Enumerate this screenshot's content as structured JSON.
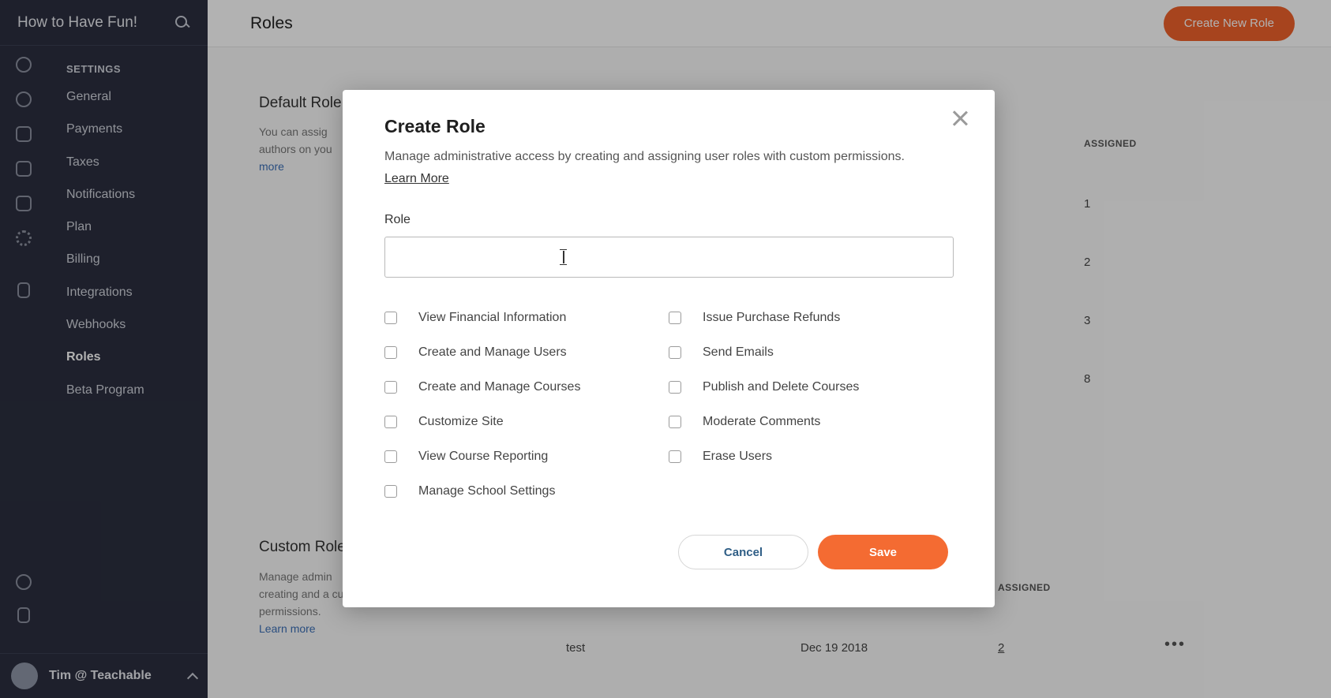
{
  "sidebar": {
    "school_name": "How to Have Fun!",
    "section_label": "SETTINGS",
    "items": [
      {
        "label": "General"
      },
      {
        "label": "Payments"
      },
      {
        "label": "Taxes"
      },
      {
        "label": "Notifications"
      },
      {
        "label": "Plan"
      },
      {
        "label": "Billing"
      },
      {
        "label": "Integrations"
      },
      {
        "label": "Webhooks"
      },
      {
        "label": "Roles"
      },
      {
        "label": "Beta Program"
      }
    ],
    "active_item": "Roles",
    "user_name": "Tim @ Teachable"
  },
  "header": {
    "title": "Roles",
    "create_button_label": "Create New Role"
  },
  "background": {
    "default_roles_heading": "Default Role",
    "default_roles_desc": "You can assig authors on you",
    "default_roles_more": "more",
    "default_assigned_header": "ASSIGNED",
    "default_assigned_values": [
      "1",
      "2",
      "3",
      "8"
    ],
    "custom_roles_heading": "Custom Role",
    "custom_roles_desc": "Manage admin creating and a custom permissions.",
    "custom_roles_learn_more": "Learn more",
    "custom_assigned_header": "ASSIGNED",
    "custom_row": {
      "name": "test",
      "date": "Dec 19 2018",
      "assigned": "2",
      "menu": "•••"
    }
  },
  "modal": {
    "title": "Create Role",
    "description": "Manage administrative access by creating and assigning user roles with custom permissions.",
    "learn_more_label": "Learn More",
    "role_label": "Role",
    "role_value": "",
    "role_placeholder": "",
    "permissions_left": [
      {
        "label": "View Financial Information",
        "checked": false
      },
      {
        "label": "Create and Manage Users",
        "checked": false
      },
      {
        "label": "Create and Manage Courses",
        "checked": false
      },
      {
        "label": "Customize Site",
        "checked": false
      },
      {
        "label": "View Course Reporting",
        "checked": false
      },
      {
        "label": "Manage School Settings",
        "checked": false
      }
    ],
    "permissions_right": [
      {
        "label": "Issue Purchase Refunds",
        "checked": false
      },
      {
        "label": "Send Emails",
        "checked": false
      },
      {
        "label": "Publish and Delete Courses",
        "checked": false
      },
      {
        "label": "Moderate Comments",
        "checked": false
      },
      {
        "label": "Erase Users",
        "checked": false
      }
    ],
    "cancel_label": "Cancel",
    "save_label": "Save"
  },
  "colors": {
    "accent": "#f46b32",
    "sidebar_bg": "#2b2f3f",
    "overlay": "rgba(0,0,0,0.3)"
  },
  "icons": [
    "search-icon",
    "dashboard-icon",
    "users-icon",
    "sitemap-icon",
    "sales-icon",
    "email-icon",
    "gear-icon",
    "tablet-icon",
    "help-icon",
    "building-icon",
    "close-icon",
    "chevron-up-icon"
  ]
}
